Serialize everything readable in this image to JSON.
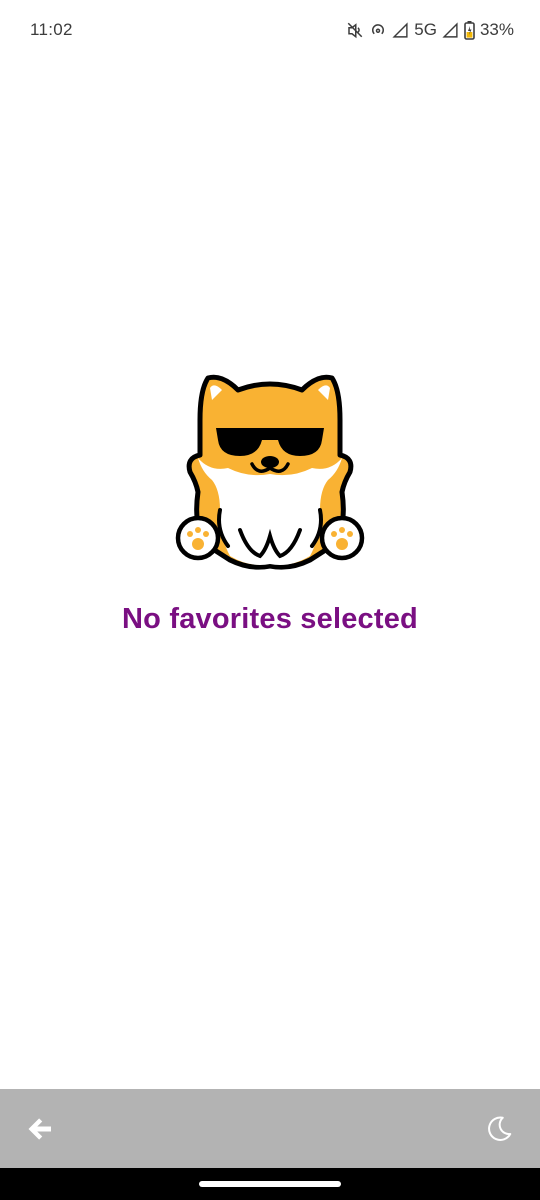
{
  "status_bar": {
    "time": "11:02",
    "network": "5G",
    "battery": "33%",
    "icons": [
      "mute-icon",
      "hotspot-icon",
      "signal-icon",
      "battery-icon"
    ]
  },
  "empty_state": {
    "message": "No favorites selected",
    "illustration": "shiba-sunglasses-mascot",
    "message_color": "#7a0f82"
  },
  "bottom_bar": {
    "background": "#b3b3b3",
    "left_icon": "back-arrow-icon",
    "right_icon": "moon-icon"
  }
}
